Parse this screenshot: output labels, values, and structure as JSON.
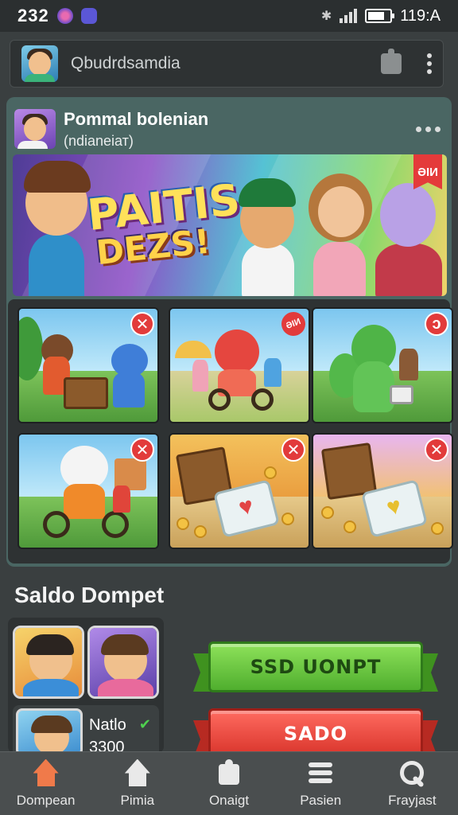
{
  "status_bar": {
    "time": "232",
    "clock": "119:A",
    "battery_level": 0.75
  },
  "top_bar": {
    "title": "Qbudrdsamdia",
    "icons": [
      "avatar",
      "share-icon",
      "more-vert-icon"
    ]
  },
  "post": {
    "title": "Pommal bolenian",
    "subtitle": "(ndianeiат)",
    "banner": {
      "line1": "PAITIS",
      "line2": "DEZS!",
      "badge": "ƏIИ"
    },
    "tiles": [
      {
        "badge": "✕",
        "theme": "jungle"
      },
      {
        "badge": "ƏIИ",
        "theme": "meadow"
      },
      {
        "badge": "ↄ",
        "theme": "dino"
      },
      {
        "badge": "✕",
        "theme": "village"
      },
      {
        "badge": "✕",
        "theme": "treasure-red"
      },
      {
        "badge": "✕",
        "theme": "treasure-gold"
      }
    ]
  },
  "wallet": {
    "section_title": "Saldo Dompet",
    "account_name": "Natlo",
    "account_amount": "3300",
    "primary_button": "SSD UONPT",
    "secondary_button": "SADO"
  },
  "nav": {
    "items": [
      {
        "label": "Dompean",
        "icon": "home-icon",
        "active": true
      },
      {
        "label": "Pimia",
        "icon": "home-icon",
        "active": false
      },
      {
        "label": "Onaigt",
        "icon": "puzzle-icon",
        "active": false
      },
      {
        "label": "Pasien",
        "icon": "list-icon",
        "active": false
      },
      {
        "label": "Frayjast",
        "icon": "search-icon",
        "active": false
      }
    ]
  },
  "colors": {
    "background": "#3a3f40",
    "card": "#4a6663",
    "accent_green": "#4fae2e",
    "accent_red": "#d8332a",
    "active_nav": "#f07a4a"
  }
}
